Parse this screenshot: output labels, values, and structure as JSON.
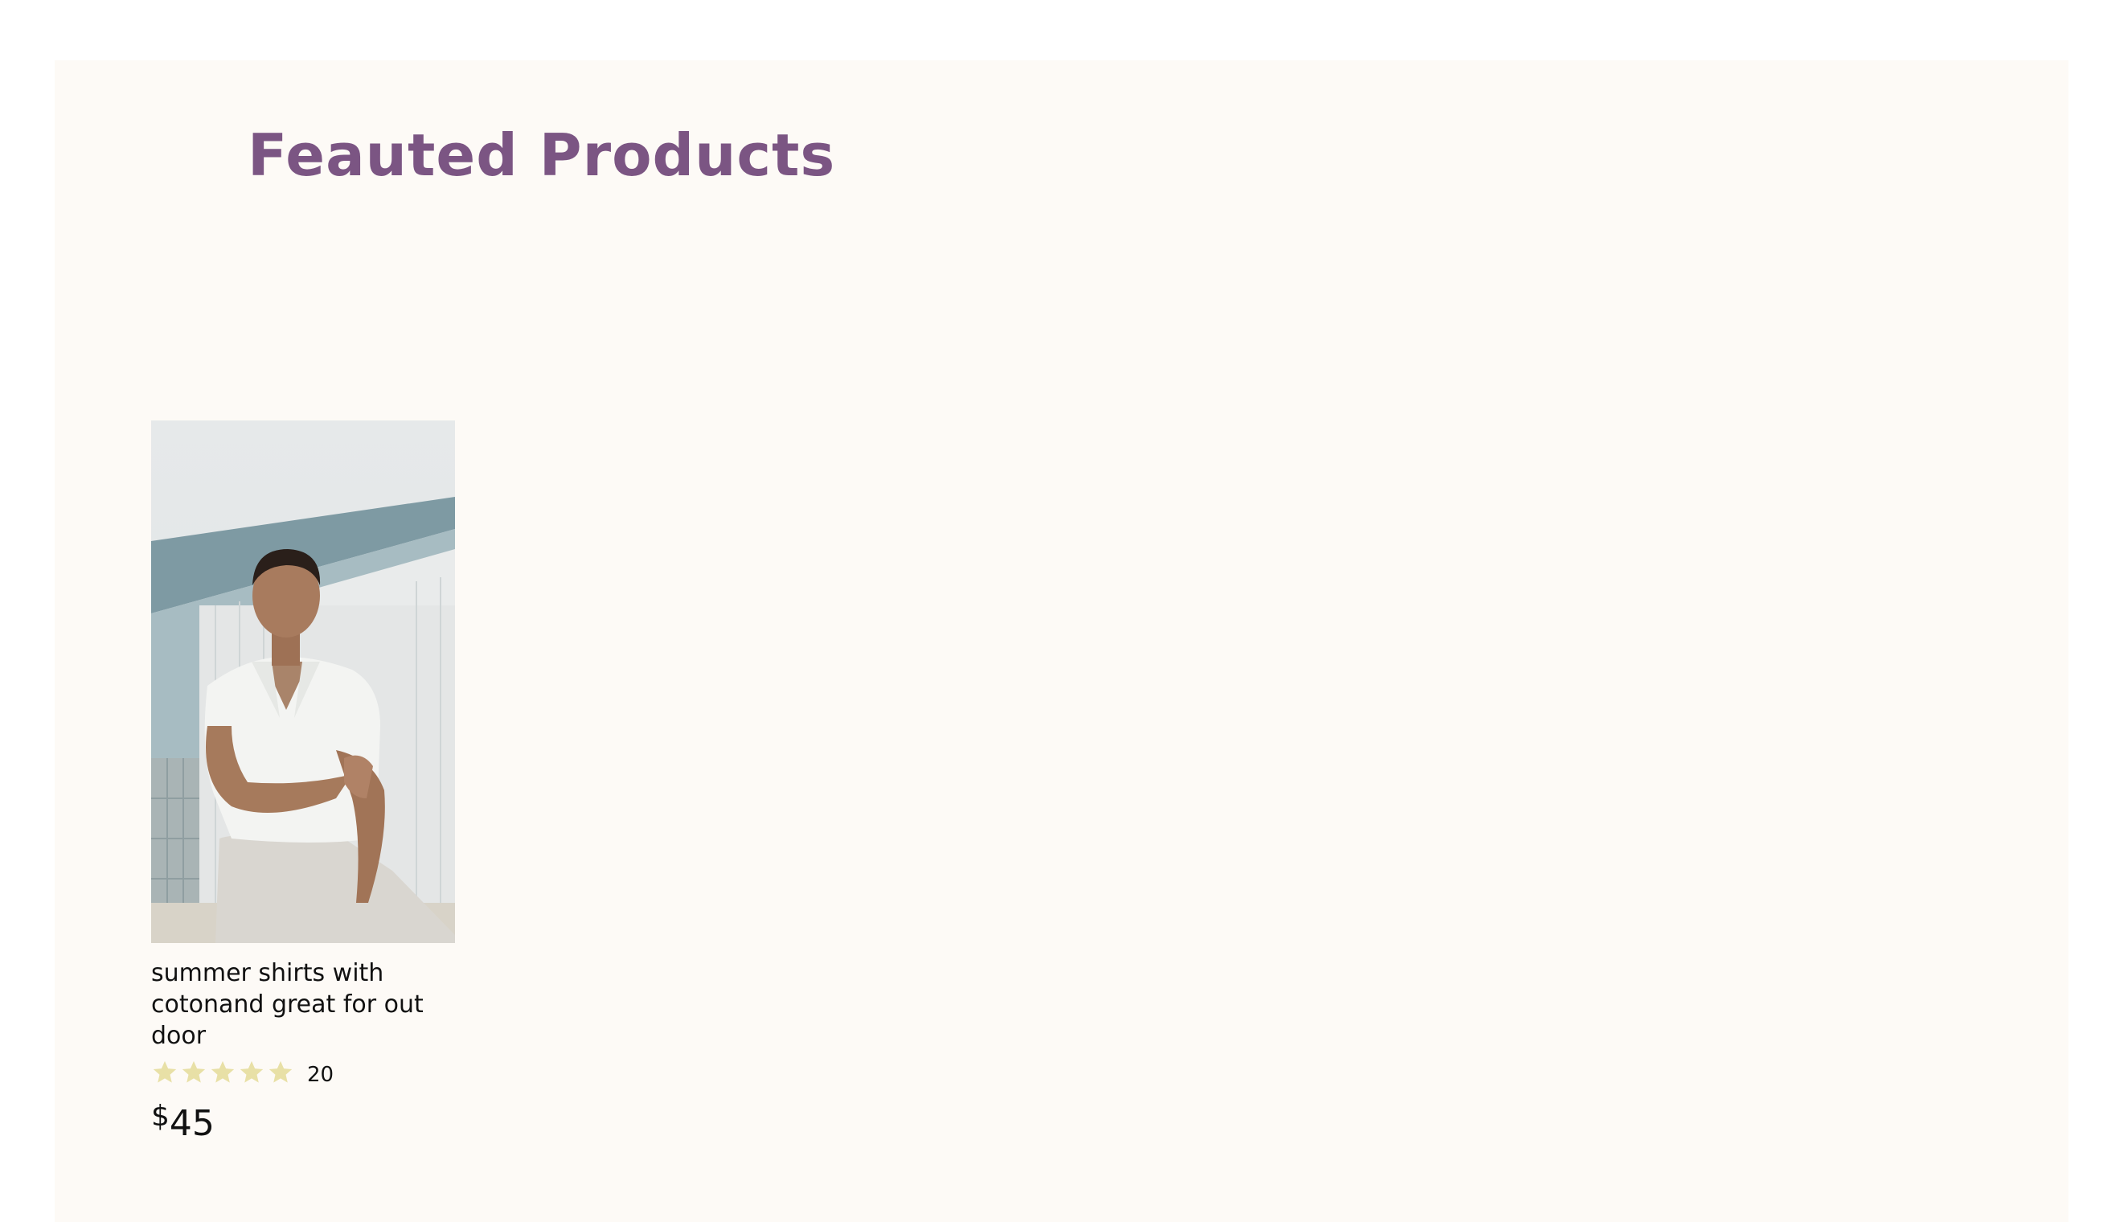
{
  "section": {
    "title": "Feauted Products"
  },
  "products": [
    {
      "name": "summer shirts with cotonand great for out door",
      "rating": 5,
      "rating_max": 5,
      "review_count": "20",
      "currency": "$",
      "price": "45",
      "star_color": "#e8e0a6"
    }
  ],
  "colors": {
    "title": "#7b5583",
    "section_background": "#fdfaf6"
  }
}
